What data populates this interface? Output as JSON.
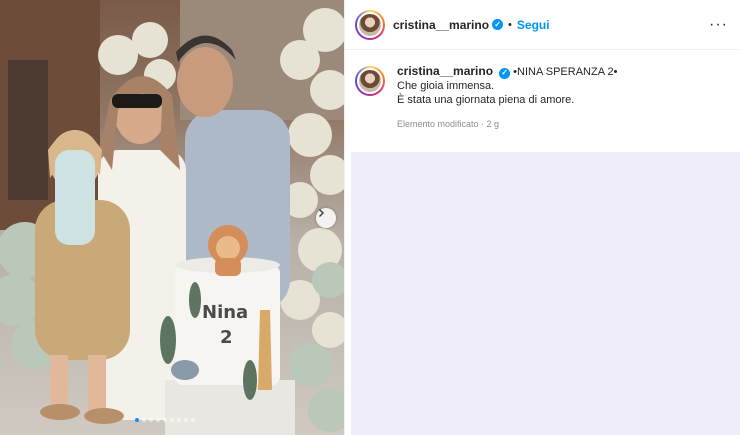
{
  "post": {
    "username": "cristina__marino",
    "separator": "•",
    "follow_label": "Segui",
    "more_label": "···",
    "caption": {
      "title": "•NINA SPERANZA 2•",
      "line1": "Che gioia immensa.",
      "line2": "È stata una giornata piena di amore."
    },
    "meta": "Elemento modificato · 2 g"
  },
  "photo": {
    "cake_text": "Nina",
    "cake_number": "2",
    "carousel_count": 9,
    "carousel_active": 0
  },
  "icons": {
    "verified": "verified-badge-icon",
    "next": "chevron-right-icon",
    "more": "more-options-icon"
  },
  "colors": {
    "accent": "#0095f6",
    "blank_area": "#f0eefb"
  }
}
